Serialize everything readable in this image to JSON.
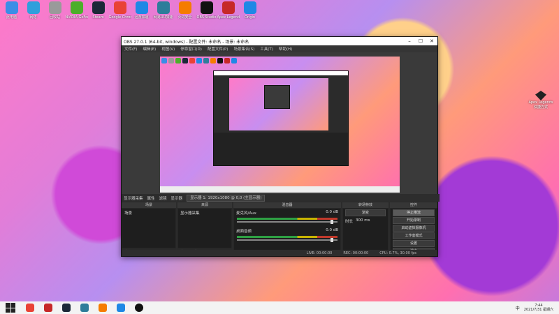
{
  "desktop": {
    "icons": [
      {
        "label": "此电脑",
        "color": "#3a8ee6"
      },
      {
        "label": "网络",
        "color": "#2f9fdc"
      },
      {
        "label": "回收站",
        "color": "#9a9a9a"
      },
      {
        "label": "NVIDIA GeForce Experience",
        "color": "#4caf2a"
      },
      {
        "label": "Steam",
        "color": "#1b2838"
      },
      {
        "label": "Google Chrome",
        "color": "#e94235"
      },
      {
        "label": "迅游加速",
        "color": "#1e88e5"
      },
      {
        "label": "网易UU加速",
        "color": "#2e7d9a"
      },
      {
        "label": "火绒安全",
        "color": "#f57c00"
      },
      {
        "label": "OBS Studio",
        "color": "#111111"
      },
      {
        "label": "Apex Legends",
        "color": "#c62828"
      },
      {
        "label": "Origin",
        "color": "#1e88e5"
      }
    ],
    "right_icon_label": "Apex Legends 快捷方式"
  },
  "window": {
    "title": "OBS 27.0.1 (64-bit, windows) - 配置文件: 未命名 - 场景: 未命名",
    "menu": [
      "文件(F)",
      "编辑(E)",
      "视图(V)",
      "停靠窗口(D)",
      "配置文件(P)",
      "场景集合(S)",
      "工具(T)",
      "帮助(H)"
    ],
    "toolbar": {
      "properties": "属性",
      "filters": "滤镜",
      "display_label": "显示器",
      "display_value": "显示器 1: 1920x1080 @ 0,0 (主显示器)"
    },
    "source_name": "显示器采集",
    "docks": {
      "scenes": {
        "title": "场景",
        "items": [
          "场景"
        ]
      },
      "sources": {
        "title": "来源",
        "items": [
          "显示器采集"
        ]
      },
      "mixer": {
        "title": "混音器",
        "channels": [
          {
            "name": "麦克风/Aux",
            "db": "0.0 dB"
          },
          {
            "name": "桌面音频",
            "db": "0.0 dB"
          }
        ]
      },
      "transitions": {
        "title": "转场特效",
        "type": "渐变",
        "duration_label": "时长",
        "duration": "300 ms"
      },
      "controls": {
        "title": "控件",
        "buttons": [
          "停止推流",
          "开始录制",
          "启动虚拟摄像机",
          "工作室模式",
          "设置",
          "退出"
        ]
      }
    },
    "status": {
      "live": "LIVE: 00:00:00",
      "rec": "REC: 00:00:00",
      "cpu": "CPU: 0.7%, 30.00 fps"
    }
  },
  "taskbar": {
    "time": "7:44",
    "date": "2021/7/31 星期六",
    "tray_text": "中"
  }
}
